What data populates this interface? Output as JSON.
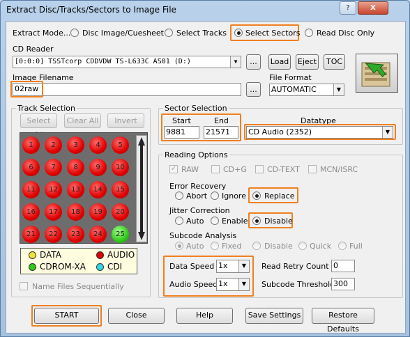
{
  "window": {
    "title": "Extract Disc/Tracks/Sectors to Image File",
    "help_glyph": "?",
    "close_glyph": "X"
  },
  "mode": {
    "label": "Extract Mode...",
    "options": [
      "Disc Image/Cuesheet",
      "Select Tracks",
      "Select Sectors",
      "Read Disc Only"
    ],
    "selected": "Select Sectors"
  },
  "reader": {
    "label": "CD Reader",
    "value": "[0:0:0] TSSTcorp CDDVDW TS-L633C  AS01 (D:)",
    "browse": "...",
    "load": "Load",
    "eject": "Eject",
    "toc": "TOC"
  },
  "image": {
    "label": "Image Filename",
    "value": "02raw",
    "browse": "..."
  },
  "format": {
    "label": "File Format",
    "value": "AUTOMATIC"
  },
  "tracks": {
    "label": "Track Selection",
    "select_all": "Select All",
    "clear_all": "Clear All",
    "invert": "Invert",
    "items": [
      "1",
      "2",
      "3",
      "4",
      "5",
      "6",
      "7",
      "8",
      "9",
      "10",
      "11",
      "12",
      "13",
      "14",
      "15",
      "16",
      "17",
      "18",
      "19",
      "20",
      "21",
      "22",
      "23",
      "24",
      "25"
    ],
    "legend": [
      "DATA",
      "AUDIO",
      "CDROM-XA",
      "CDI"
    ],
    "name_files": "Name Files Sequentially"
  },
  "sectors": {
    "label": "Sector Selection",
    "start_label": "Start",
    "end_label": "End",
    "start": "9881",
    "end": "21571",
    "datatype_label": "Datatype",
    "datatype": "CD Audio (2352)"
  },
  "reading": {
    "label": "Reading Options",
    "checks": [
      "RAW",
      "CD+G",
      "CD-TEXT",
      "MCN/ISRC"
    ],
    "error_label": "Error Recovery",
    "error": [
      "Abort",
      "Ignore",
      "Replace"
    ],
    "jitter_label": "Jitter Correction",
    "jitter": [
      "Auto",
      "Enable",
      "Disable"
    ],
    "subcode_label": "Subcode Analysis",
    "subcode": [
      "Auto",
      "Fixed",
      "Disable",
      "Quick",
      "Full"
    ],
    "data_speed_label": "Data Speed",
    "data_speed": "1x",
    "audio_speed_label": "Audio Speed",
    "audio_speed": "1x",
    "retry_label": "Read Retry Count",
    "retry": "0",
    "threshold_label": "Subcode Threshold",
    "threshold": "300"
  },
  "buttons": {
    "start": "START",
    "close": "Close",
    "help": "Help",
    "save": "Save Settings",
    "restore": "Restore Defaults"
  },
  "colors": {
    "highlight": "#f08020",
    "track_audio": "#e00000",
    "track_data": "#2fc81b"
  }
}
